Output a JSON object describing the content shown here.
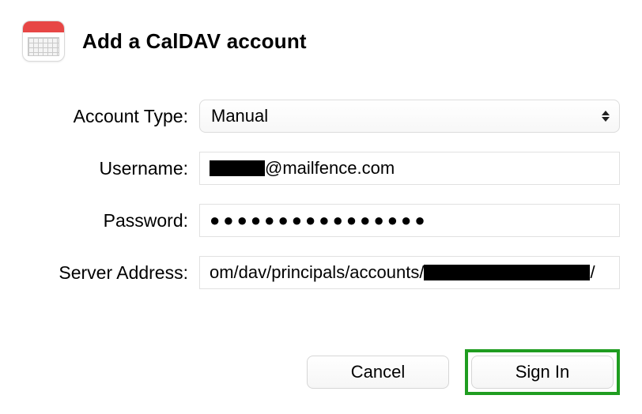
{
  "header": {
    "title": "Add a CalDAV account"
  },
  "icons": {
    "calendar": "calendar-icon",
    "select_chevron": "chevron-up-down-icon"
  },
  "form": {
    "account_type": {
      "label": "Account Type:",
      "value": "Manual"
    },
    "username": {
      "label": "Username:",
      "value_suffix": "@mailfence.com"
    },
    "password": {
      "label": "Password:",
      "masked": "●●●●●●●●●●●●●●●●"
    },
    "server": {
      "label": "Server Address:",
      "value_prefix": "om/dav/principals/accounts/",
      "value_suffix": "/"
    }
  },
  "footer": {
    "cancel": "Cancel",
    "signin": "Sign In"
  },
  "colors": {
    "highlight_border": "#1f9d20",
    "icon_accent": "#e74645"
  }
}
